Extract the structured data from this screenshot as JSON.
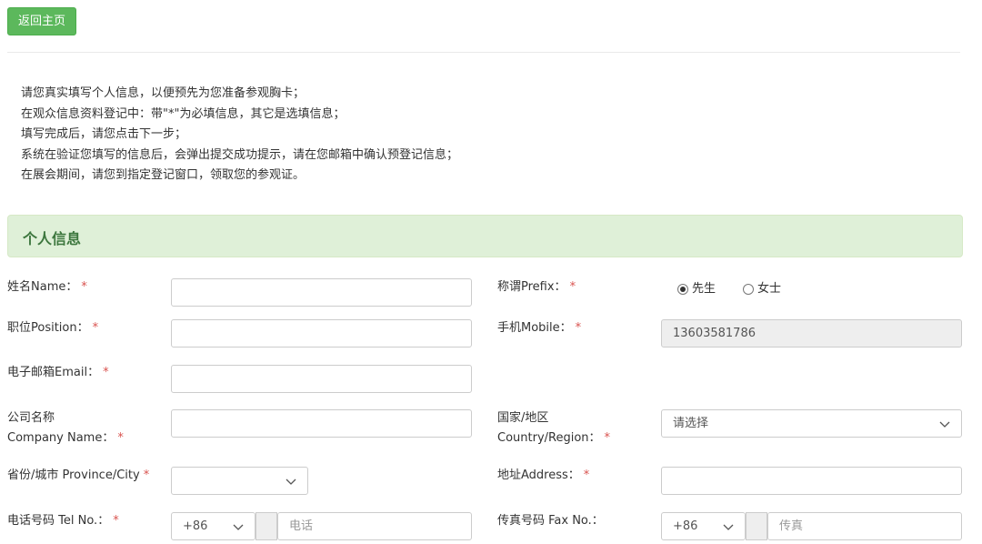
{
  "header": {
    "back_home_label": "返回主页"
  },
  "intro": {
    "lines": [
      "请您真实填写个人信息，以便预先为您准备参观胸卡；",
      "在观众信息资料登记中：带\"*\"为必填信息，其它是选填信息；",
      "填写完成后，请您点击下一步；",
      "系统在验证您填写的信息后，会弹出提交成功提示，请在您邮箱中确认预登记信息；",
      "在展会期间，请您到指定登记窗口，领取您的参观证。"
    ]
  },
  "section": {
    "title": "个人信息"
  },
  "form": {
    "required_mark": "*",
    "name": {
      "label": "姓名Name：",
      "value": ""
    },
    "prefix": {
      "label": "称谓Prefix：",
      "options": [
        {
          "label": "先生",
          "checked": true
        },
        {
          "label": "女士",
          "checked": false
        }
      ]
    },
    "position": {
      "label": "职位Position：",
      "value": ""
    },
    "mobile": {
      "label": "手机Mobile：",
      "value": "13603581786"
    },
    "email": {
      "label": "电子邮箱Email：",
      "value": ""
    },
    "company": {
      "label_cn": "公司名称",
      "label_en": "Company Name：",
      "value": ""
    },
    "country": {
      "label_cn": "国家/地区",
      "label_en": "Country/Region：",
      "value": "请选择"
    },
    "province": {
      "label": "省份/城市 Province/City",
      "value": ""
    },
    "address": {
      "label": "地址Address：",
      "value": ""
    },
    "tel": {
      "label": "电话号码 Tel No.：",
      "code": "+86",
      "placeholder": "电话"
    },
    "fax": {
      "label": "传真号码 Fax No.：",
      "code": "+86",
      "placeholder": "传真"
    }
  },
  "colors": {
    "accent_green": "#5cb85c",
    "header_bg": "#dff0d8",
    "header_text": "#3c763d",
    "required": "#d9534f"
  }
}
